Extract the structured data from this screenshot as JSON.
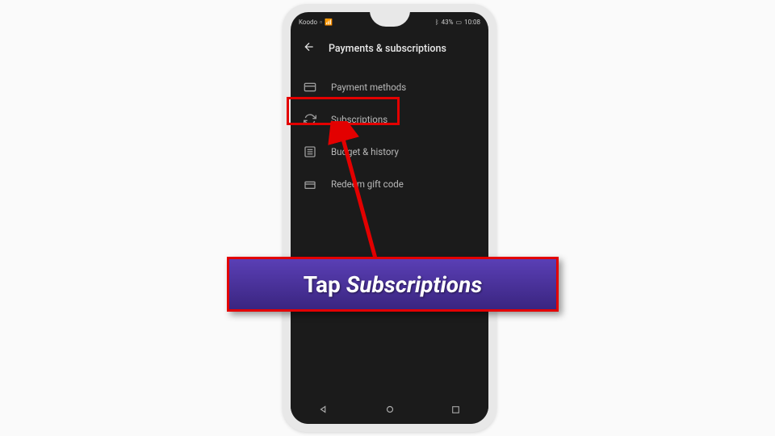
{
  "status": {
    "carrier": "Koodo",
    "signal_icons": "📶 ⇅ 📡",
    "bluetooth": "",
    "battery_pct": "43%",
    "time": "10:08"
  },
  "header": {
    "title": "Payments & subscriptions"
  },
  "menu": {
    "items": [
      {
        "label": "Payment methods",
        "icon": "card"
      },
      {
        "label": "Subscriptions",
        "icon": "sync"
      },
      {
        "label": "Budget & history",
        "icon": "list"
      },
      {
        "label": "Redeem gift code",
        "icon": "gift"
      }
    ]
  },
  "callout": {
    "prefix": "Tap ",
    "emphasis": "Subscriptions"
  }
}
